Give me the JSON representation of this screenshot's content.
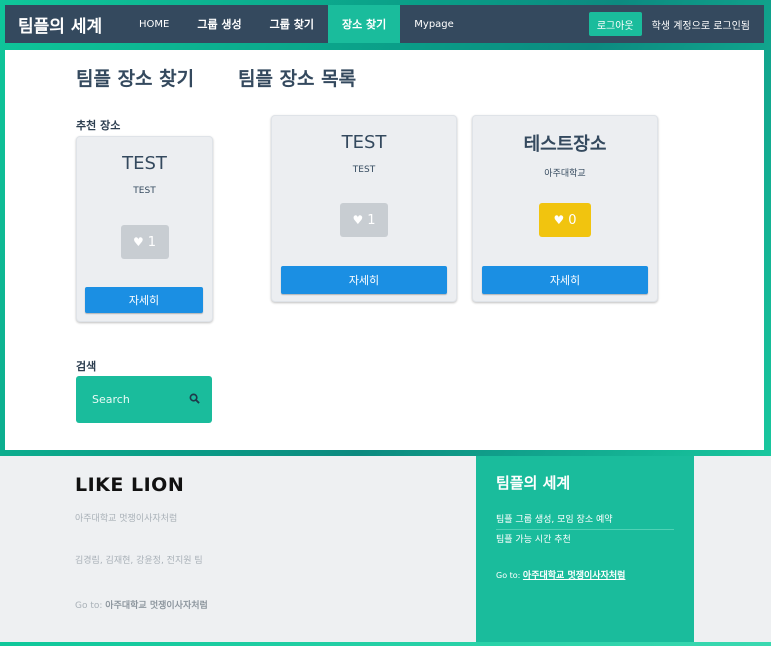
{
  "nav": {
    "brand": "팀플의 세계",
    "links": [
      "HOME",
      "그룹 생성",
      "그룹 찾기",
      "장소 찾기",
      "Mypage"
    ],
    "logout": "로그아웃",
    "status": "학생 계정으로 로그인됨"
  },
  "main": {
    "heading_find": "팀플 장소 찾기",
    "heading_list": "팀플 장소 목록",
    "recommended_label": "추천 장소",
    "search_label": "검색",
    "search_placeholder": "Search",
    "detail_label": "자세히",
    "recommended_card": {
      "title": "TEST",
      "subtitle": "TEST",
      "likes": "1"
    },
    "places": [
      {
        "title": "TEST",
        "subtitle": "TEST",
        "likes": "1",
        "liked": false
      },
      {
        "title": "테스트장소",
        "subtitle": "아주대학교",
        "likes": "0",
        "liked": true
      }
    ]
  },
  "footer": {
    "logo": "LIKE LION",
    "org": "아주대학교 멋쟁이사자처럼",
    "members": "김경림, 김재현, 강윤정, 전지원 팀",
    "goto_prefix": "Go to:",
    "goto_link": "아주대학교 멋쟁이사자처럼",
    "panel_title": "팀플의 세계",
    "panel_items": [
      "팀플 그룹 생성, 모임 장소 예약",
      "팀플 가능 시간 추천"
    ]
  },
  "colors": {
    "navbar": "#34495e",
    "accent": "#1abc9c",
    "detail_button": "#1b8fe3",
    "like_on": "#f1c40f",
    "like_off": "#c8cdd2"
  }
}
